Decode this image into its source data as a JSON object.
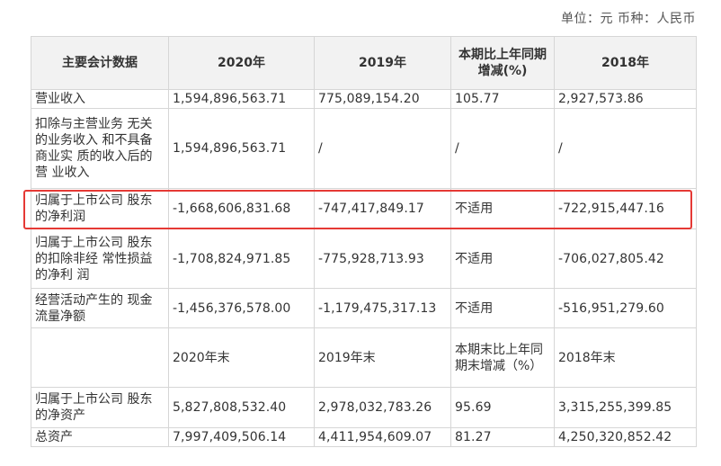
{
  "unit_label": "单位：元 币种：人民币",
  "header": {
    "col1": "主要会计数据",
    "col2": "2020年",
    "col3": "2019年",
    "col4": "本期比上年同期增减(%)",
    "col5": "2018年"
  },
  "rows": [
    {
      "label": "营业收入",
      "v2020": "1,594,896,563.71",
      "v2019": "775,089,154.20",
      "change": "105.77",
      "v2018": "2,927,573.86"
    },
    {
      "label": "扣除与主营业务 无关的业务收入 和不具备商业实 质的收入后的营 业收入",
      "v2020": "1,594,896,563.71",
      "v2019": "/",
      "change": "/",
      "v2018": "/"
    },
    {
      "label": "归属于上市公司 股东的净利润",
      "v2020": "-1,668,606,831.68",
      "v2019": "-747,417,849.17",
      "change": "不适用",
      "v2018": "-722,915,447.16"
    },
    {
      "label": "归属于上市公司 股东的扣除非经 常性损益的净利 润",
      "v2020": "-1,708,824,971.85",
      "v2019": "-775,928,713.93",
      "change": "不适用",
      "v2018": "-706,027,805.42"
    },
    {
      "label": "经营活动产生的 现金流量净额",
      "v2020": "-1,456,376,578.00",
      "v2019": "-1,179,475,317.13",
      "change": "不适用",
      "v2018": "-516,951,279.60"
    }
  ],
  "subheader": {
    "col1": "",
    "col2": "2020年末",
    "col3": "2019年末",
    "col4": "本期末比上年同期末增减（%）",
    "col5": "2018年末"
  },
  "rows2": [
    {
      "label": "归属于上市公司 股东的净资产",
      "v2020": "5,827,808,532.40",
      "v2019": "2,978,032,783.26",
      "change": "95.69",
      "v2018": "3,315,255,399.85"
    },
    {
      "label": "总资产",
      "v2020": "7,997,409,506.14",
      "v2019": "4,411,954,609.07",
      "change": "81.27",
      "v2018": "4,250,320,852.42"
    }
  ]
}
